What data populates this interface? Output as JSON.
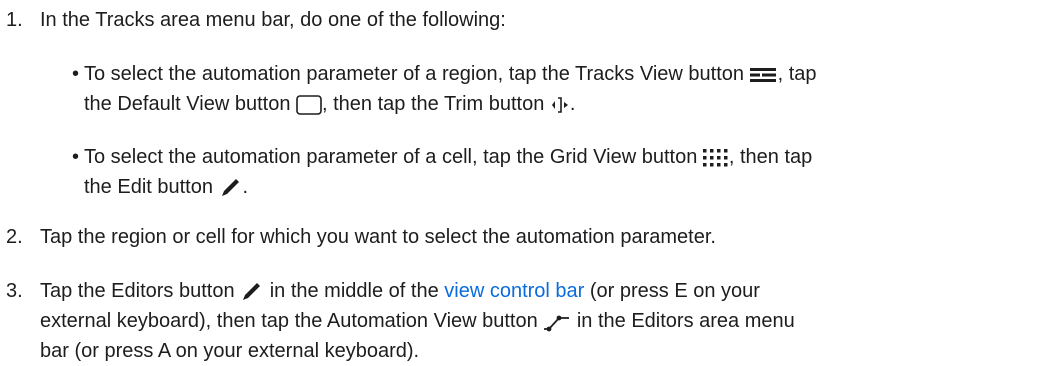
{
  "steps": [
    {
      "number": "1.",
      "text": "In the Tracks area menu bar, do one of the following:"
    },
    {
      "number": "2.",
      "text": "Tap the region or cell for which you want to select the automation parameter."
    },
    {
      "number": "3.",
      "p1": "Tap the Editors button",
      "p2": "in the middle of the",
      "link": "view control bar",
      "p3": "(or press E on your",
      "line2a": "external keyboard), then tap the Automation View button",
      "line2b": "in the Editors area menu",
      "line3": "bar (or press A on your external keyboard)."
    }
  ],
  "bullets": [
    {
      "a": "To select the automation parameter of a region, tap the Tracks View button",
      "b": ", tap",
      "c": "the Default View button",
      "d": ", then tap the Trim button",
      "e": "."
    },
    {
      "a": "To select the automation parameter of a cell, tap the Grid View button",
      "b": ", then tap",
      "c": "the Edit button",
      "d": "."
    }
  ],
  "icons": [
    "tracks-view-icon",
    "default-view-icon",
    "trim-icon",
    "grid-view-icon",
    "edit-icon",
    "editors-icon",
    "automation-view-icon"
  ],
  "colors": {
    "text": "#1d1d1f",
    "link": "#0a6cdc"
  }
}
